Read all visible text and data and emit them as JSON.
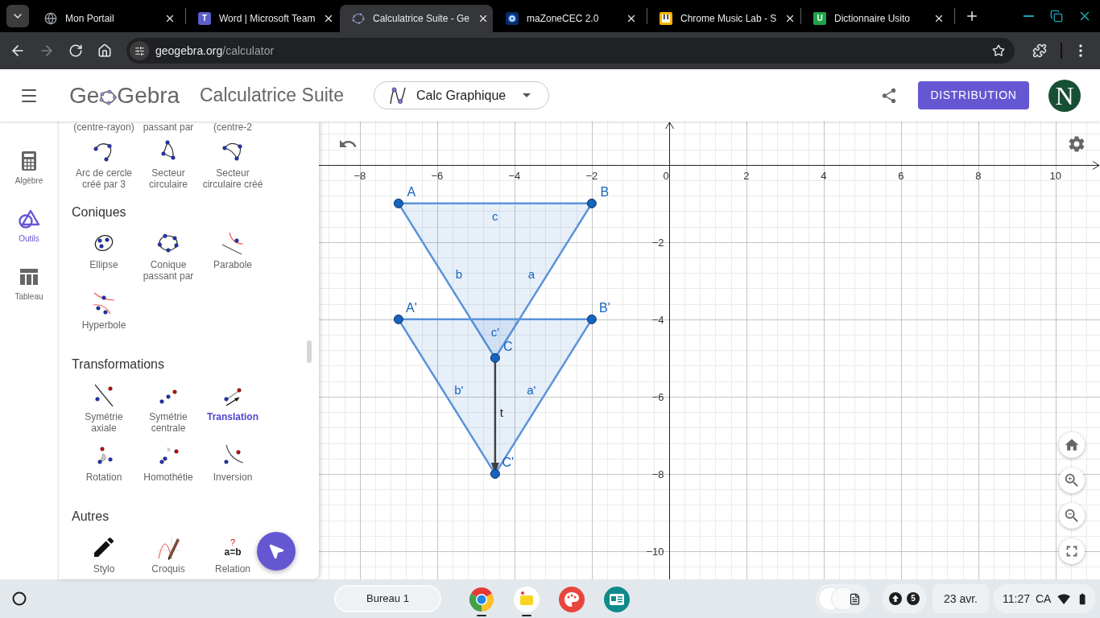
{
  "browser": {
    "tabs": [
      {
        "kind": "globe",
        "title": "Mon Portail",
        "selected": false
      },
      {
        "kind": "teams",
        "badge": "T",
        "title": "Word | Microsoft Team",
        "selected": false
      },
      {
        "kind": "ring",
        "title": "Calculatrice Suite - Ge",
        "selected": true
      },
      {
        "kind": "target",
        "title": "maZoneCEC 2.0",
        "selected": false
      },
      {
        "kind": "piano",
        "title": "Chrome Music Lab - S",
        "selected": false
      },
      {
        "kind": "usito",
        "badge": "U",
        "title": "Dictionnaire Usito",
        "selected": false
      }
    ],
    "nav": {
      "forward_disabled": true
    },
    "address": {
      "host": "geogebra.org",
      "path": "/calculator"
    }
  },
  "header": {
    "logo": {
      "left": "Ge",
      "right": "Gebra"
    },
    "title": "Calculatrice Suite",
    "app_select": "Calc Graphique",
    "button": "DISTRIBUTION",
    "avatar": "N"
  },
  "rail": [
    {
      "kind": "calculator",
      "label": "Algèbre",
      "selected": false
    },
    {
      "kind": "tools",
      "label": "Outils",
      "selected": true
    },
    {
      "kind": "table",
      "label": "Tableau",
      "selected": false
    }
  ],
  "tools_panel": {
    "cut_labels": [
      "(centre-rayon)",
      "passant par",
      "(centre-2"
    ],
    "sections": [
      {
        "tools": [
          {
            "kind": "arc3",
            "label": "Arc de cercle créé par 3",
            "selected": false
          },
          {
            "kind": "sector",
            "label": "Secteur circulaire",
            "selected": false
          },
          {
            "kind": "sector3",
            "label": "Secteur circulaire créé",
            "selected": false
          }
        ]
      },
      {
        "heading": "Coniques",
        "tools": [
          {
            "kind": "ellipse",
            "label": "Ellipse",
            "selected": false
          },
          {
            "kind": "conic5",
            "label": "Conique passant par",
            "selected": false
          },
          {
            "kind": "parabola",
            "label": "Parabole",
            "selected": false
          },
          {
            "kind": "hyperbola",
            "label": "Hyperbole",
            "selected": false
          }
        ]
      },
      {
        "heading": "Transformations",
        "tools": [
          {
            "kind": "reflect_line",
            "label": "Symétrie axiale",
            "selected": false
          },
          {
            "kind": "reflect_point",
            "label": "Symétrie centrale",
            "selected": false
          },
          {
            "kind": "translate",
            "label": "Translation",
            "selected": true
          },
          {
            "kind": "rotate",
            "label": "Rotation",
            "selected": false
          },
          {
            "kind": "dilate",
            "label": "Homothétie",
            "icon_text": "k",
            "selected": false
          },
          {
            "kind": "inversion",
            "label": "Inversion",
            "selected": false
          }
        ]
      },
      {
        "heading": "Autres",
        "tools": [
          {
            "kind": "pen",
            "label": "Stylo",
            "selected": false
          },
          {
            "kind": "sketch",
            "label": "Croquis",
            "selected": false
          },
          {
            "kind": "relation",
            "label": "Relation",
            "icon_text": "a=b",
            "icon_mark": "?",
            "selected": false
          }
        ]
      }
    ]
  },
  "graph": {
    "chart_data": {
      "type": "scatter",
      "grid": true,
      "x": [
        -7,
        -2,
        -4.5
      ],
      "series": [
        {
          "name": "A",
          "color": "#1565c0",
          "values": [
            -1,
            null,
            null
          ]
        },
        {
          "name": "B",
          "color": "#1565c0",
          "values": [
            null,
            -1,
            null
          ]
        },
        {
          "name": "C",
          "color": "#1565c0",
          "values": [
            null,
            null,
            -5
          ]
        },
        {
          "name": "A'",
          "color": "#1565c0",
          "values": [
            -4,
            null,
            null
          ]
        },
        {
          "name": "B'",
          "color": "#1565c0",
          "values": [
            null,
            -4,
            null
          ]
        },
        {
          "name": "C'",
          "color": "#1565c0",
          "values": [
            null,
            null,
            -8
          ]
        }
      ],
      "xlim": [
        -9.06,
        11.15
      ],
      "ylim": [
        -10.73,
        1.12
      ],
      "xticks": [
        {
          "value": -8,
          "label": "−8"
        },
        {
          "value": -6,
          "label": "−6"
        },
        {
          "value": -4,
          "label": "−4"
        },
        {
          "value": -2,
          "label": "−2"
        },
        {
          "value": 0,
          "label": "0"
        },
        {
          "value": 2,
          "label": "2"
        },
        {
          "value": 4,
          "label": "4"
        },
        {
          "value": 6,
          "label": "6"
        },
        {
          "value": 8,
          "label": "8"
        },
        {
          "value": 10,
          "label": "10"
        }
      ],
      "yticks": [
        {
          "value": -2,
          "label": "−2"
        },
        {
          "value": -4,
          "label": "−4"
        },
        {
          "value": -6,
          "label": "−6"
        },
        {
          "value": -8,
          "label": "−8"
        },
        {
          "value": -10,
          "label": "−10"
        }
      ],
      "annotations": [
        "c",
        "b",
        "a",
        "c'",
        "b'",
        "a'",
        "t"
      ]
    }
  },
  "taskbar": {
    "desk": "Bureau 1",
    "apps": [
      {
        "kind": "chrome",
        "running": true
      },
      {
        "kind": "spark",
        "running": true
      },
      {
        "kind": "palette",
        "running": false
      },
      {
        "kind": "card",
        "running": false
      }
    ],
    "uploads": "5",
    "date": "23 avr.",
    "time": "11:27",
    "locale": "CA"
  }
}
